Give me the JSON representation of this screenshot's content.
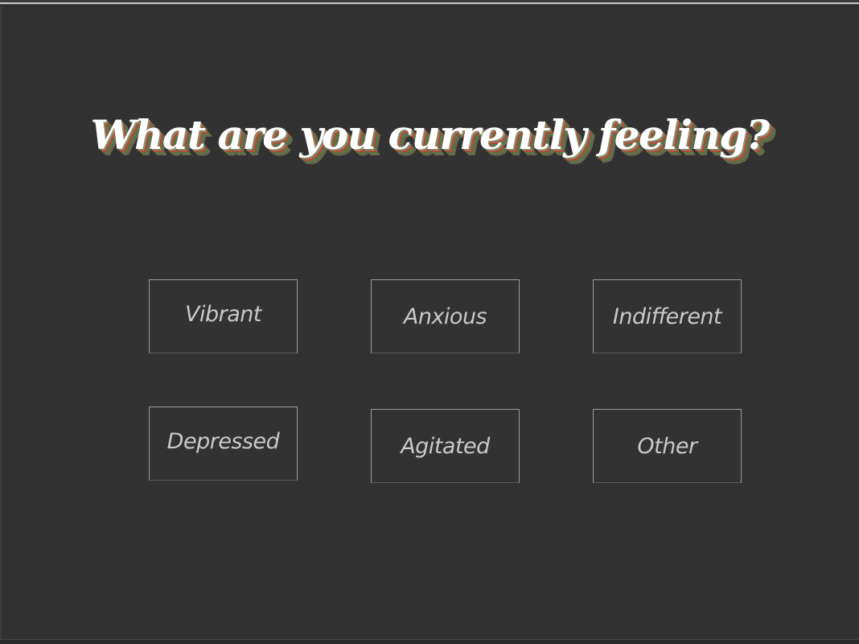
{
  "page": {
    "title": "What are you currently feeling?"
  },
  "options": [
    {
      "label": "Vibrant"
    },
    {
      "label": "Anxious"
    },
    {
      "label": "Indifferent"
    },
    {
      "label": "Depressed"
    },
    {
      "label": "Agitated"
    },
    {
      "label": "Other"
    }
  ],
  "colors": {
    "background": "#323232",
    "title_text": "#ffffff",
    "title_shadow_1": "#b04a38",
    "title_shadow_2": "#4f7a48",
    "option_text": "#c9c9c9",
    "option_border": "#9a9a9a"
  }
}
